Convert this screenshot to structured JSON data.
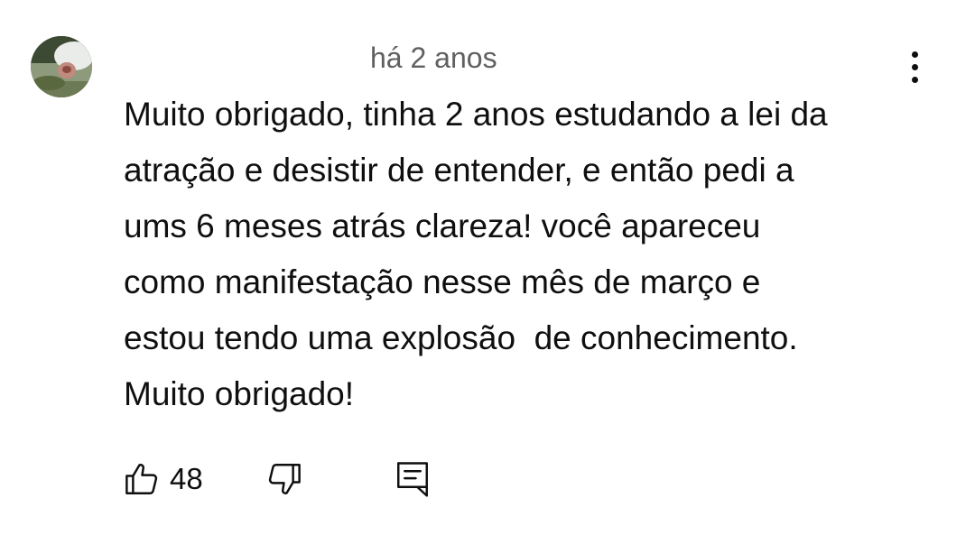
{
  "comment": {
    "timestamp": "há 2 anos",
    "text_lines": [
      "Muito obrigado, tinha 2 anos estudando a lei da",
      "atração e desistir de entender, e então pedi a",
      "ums 6 meses atrás clareza! você apareceu",
      "como manifestação nesse mês de março e",
      "estou tendo uma explosão  de conhecimento.",
      "Muito obrigado!"
    ],
    "like_count": "48",
    "icons": {
      "like": "thumbs-up-icon",
      "dislike": "thumbs-down-icon",
      "reply": "reply-comment-icon",
      "more": "more-vertical-icon"
    }
  },
  "colors": {
    "text": "#0f0f0f",
    "secondary_text": "#606060",
    "background": "#ffffff"
  }
}
